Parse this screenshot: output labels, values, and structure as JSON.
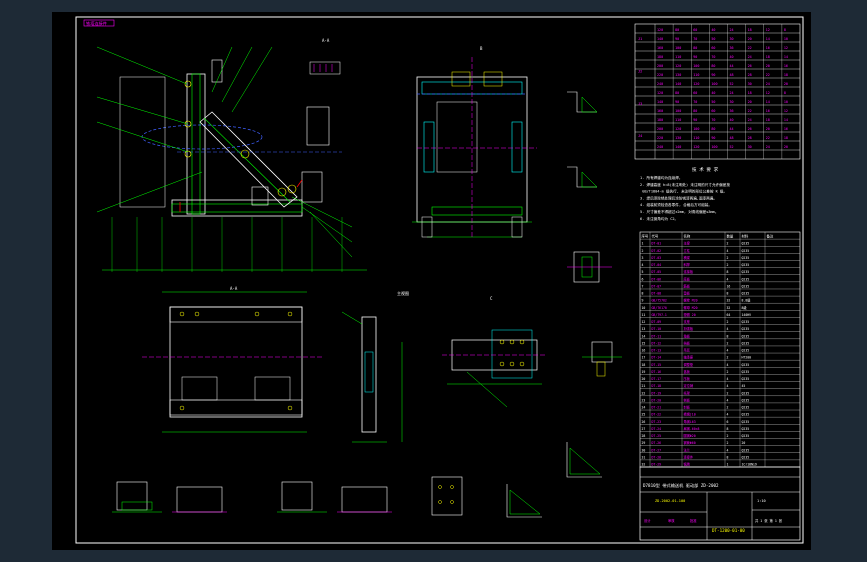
{
  "window": {
    "title": ""
  },
  "drawing": {
    "tag": "铁塔连接件",
    "views": {
      "side_a": "A-A",
      "detail_b": "B",
      "section_title": "主视图",
      "lower_view": "A-A",
      "c_view": "C",
      "detail_p": "P向",
      "k2": "K-2",
      "d_label": "D"
    },
    "notes": {
      "title": "技 术 要 求",
      "lines": [
        "1. 所有焊缝均为连续焊。",
        "2. 焊缝高度 h=8(未注明处) 未注明的尺寸允许偏差按",
        "   GB/T1804-m 级执行, 未注明的形位公差按 K 级。",
        "3. 焊后须除锈处理后涂防锈漆两遍,面漆两遍。",
        "4. 组装前须检查各零件, 合格后方可组装。",
        "5. 尺寸偏差不得超过±2mm, 对角线偏差≤3mm。",
        "6. 未注倒角均为 C2。"
      ]
    },
    "title_block": {
      "main_title": "D7810型 带式输送机 驱动部 ZD-2002",
      "drawing_no": "DT-1200-01-00",
      "scale": "1:10",
      "sheet": "共 1 张 第 1 张",
      "designer": "设计",
      "checker": "审核",
      "approver": "批准",
      "ref": "ZD-2002-01-100"
    },
    "top_table": {
      "groups": [
        "J1",
        "J2",
        "J3",
        "J4"
      ],
      "rows": [
        [
          "120",
          "80",
          "60",
          "40",
          "24",
          "18",
          "12",
          "8"
        ],
        [
          "140",
          "90",
          "70",
          "50",
          "30",
          "20",
          "14",
          "10"
        ],
        [
          "160",
          "100",
          "80",
          "60",
          "36",
          "22",
          "16",
          "12"
        ],
        [
          "180",
          "110",
          "90",
          "70",
          "40",
          "24",
          "18",
          "14"
        ],
        [
          "200",
          "120",
          "100",
          "80",
          "44",
          "26",
          "20",
          "16"
        ],
        [
          "220",
          "130",
          "110",
          "90",
          "48",
          "28",
          "22",
          "18"
        ],
        [
          "240",
          "140",
          "120",
          "100",
          "52",
          "30",
          "24",
          "20"
        ]
      ]
    },
    "parts_list": {
      "header": [
        "序号",
        "代号",
        "名称",
        "数量",
        "材料",
        "备注"
      ],
      "rows": [
        [
          "1",
          "DT-01",
          "主梁",
          "2",
          "Q235",
          ""
        ],
        [
          "2",
          "DT-02",
          "立柱",
          "4",
          "Q235",
          ""
        ],
        [
          "3",
          "DT-03",
          "横梁",
          "2",
          "Q235",
          ""
        ],
        [
          "4",
          "DT-04",
          "斜撑",
          "2",
          "Q235",
          ""
        ],
        [
          "5",
          "DT-05",
          "连接板",
          "8",
          "Q235",
          ""
        ],
        [
          "6",
          "DT-06",
          "底板",
          "4",
          "Q235",
          ""
        ],
        [
          "7",
          "DT-07",
          "筋板",
          "16",
          "Q235",
          ""
        ],
        [
          "8",
          "DT-08",
          "垫板",
          "8",
          "Q235",
          ""
        ],
        [
          "9",
          "GB/T5782",
          "螺栓 M20",
          "32",
          "8.8级",
          ""
        ],
        [
          "10",
          "GB/T6170",
          "螺母 M20",
          "32",
          "8级",
          ""
        ],
        [
          "11",
          "GB/T97.1",
          "垫圈 20",
          "64",
          "140HV",
          ""
        ],
        [
          "12",
          "DT-09",
          "支座",
          "2",
          "Q235",
          ""
        ],
        [
          "13",
          "DT-10",
          "加强板",
          "4",
          "Q235",
          ""
        ],
        [
          "14",
          "DT-11",
          "角板",
          "8",
          "Q235",
          ""
        ],
        [
          "15",
          "DT-12",
          "挡板",
          "2",
          "Q235",
          ""
        ],
        [
          "16",
          "DT-13",
          "吊耳",
          "4",
          "Q235",
          ""
        ],
        [
          "17",
          "DT-14",
          "轴承座",
          "2",
          "HT200",
          ""
        ],
        [
          "18",
          "DT-15",
          "调整垫",
          "4",
          "Q235",
          ""
        ],
        [
          "19",
          "DT-16",
          "盖板",
          "2",
          "Q235",
          ""
        ],
        [
          "20",
          "DT-17",
          "压板",
          "4",
          "Q235",
          ""
        ],
        [
          "21",
          "DT-18",
          "定位销",
          "4",
          "45",
          ""
        ],
        [
          "22",
          "DT-19",
          "托架",
          "2",
          "Q235",
          ""
        ],
        [
          "23",
          "DT-20",
          "侧板",
          "4",
          "Q235",
          ""
        ],
        [
          "24",
          "DT-21",
          "封板",
          "2",
          "Q235",
          ""
        ],
        [
          "25",
          "DT-22",
          "槽钢[10",
          "4",
          "Q235",
          ""
        ],
        [
          "26",
          "DT-23",
          "角钢L63",
          "6",
          "Q235",
          ""
        ],
        [
          "27",
          "DT-24",
          "扁钢-60×8",
          "8",
          "Q235",
          ""
        ],
        [
          "28",
          "DT-25",
          "圆钢Φ20",
          "2",
          "Q235",
          ""
        ],
        [
          "29",
          "DT-26",
          "钢管Φ60",
          "2",
          "20",
          ""
        ],
        [
          "30",
          "DT-27",
          "法兰",
          "4",
          "Q235",
          ""
        ],
        [
          "31",
          "DT-28",
          "连接件",
          "8",
          "Q235",
          ""
        ],
        [
          "32",
          "DT-29",
          "铭牌",
          "1",
          "1Cr18Ni9",
          ""
        ]
      ]
    }
  }
}
